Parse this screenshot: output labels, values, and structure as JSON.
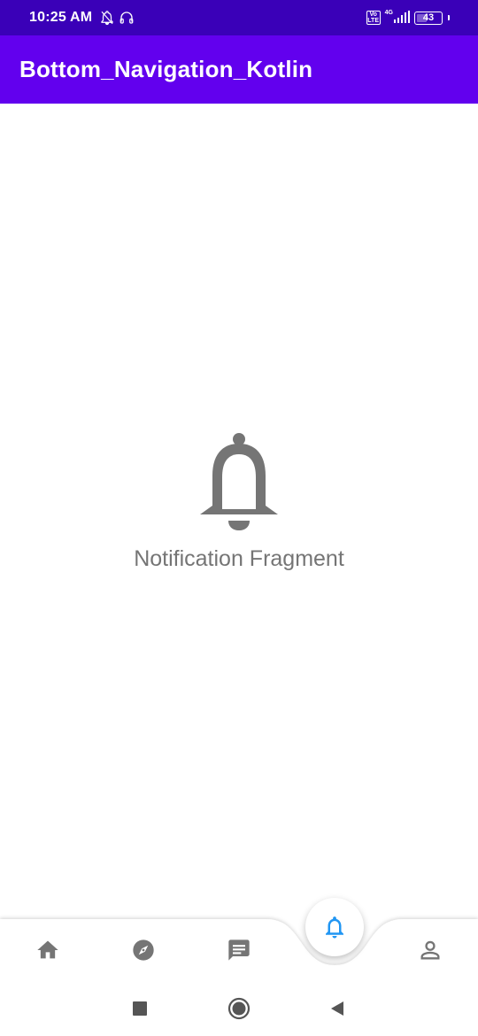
{
  "status_bar": {
    "time": "10:25 AM",
    "left_icons": [
      "notifications-off-icon",
      "headset-icon"
    ],
    "volte": "Vo LTE",
    "network": "4G",
    "battery": "43",
    "battery_level": 43
  },
  "app_bar": {
    "title": "Bottom_Navigation_Kotlin",
    "color": "#6200ee"
  },
  "content": {
    "icon": "bell-icon",
    "label": "Notification Fragment"
  },
  "bottom_nav": {
    "items": [
      {
        "icon": "home-icon",
        "selected": false
      },
      {
        "icon": "compass-icon",
        "selected": false
      },
      {
        "icon": "message-icon",
        "selected": false
      },
      {
        "icon": "bell-icon",
        "selected": true
      },
      {
        "icon": "person-icon",
        "selected": false
      }
    ],
    "selected_color": "#2196f3",
    "icon_color": "#757575"
  },
  "system_nav": [
    "recents-icon",
    "home-circle-icon",
    "back-icon"
  ]
}
